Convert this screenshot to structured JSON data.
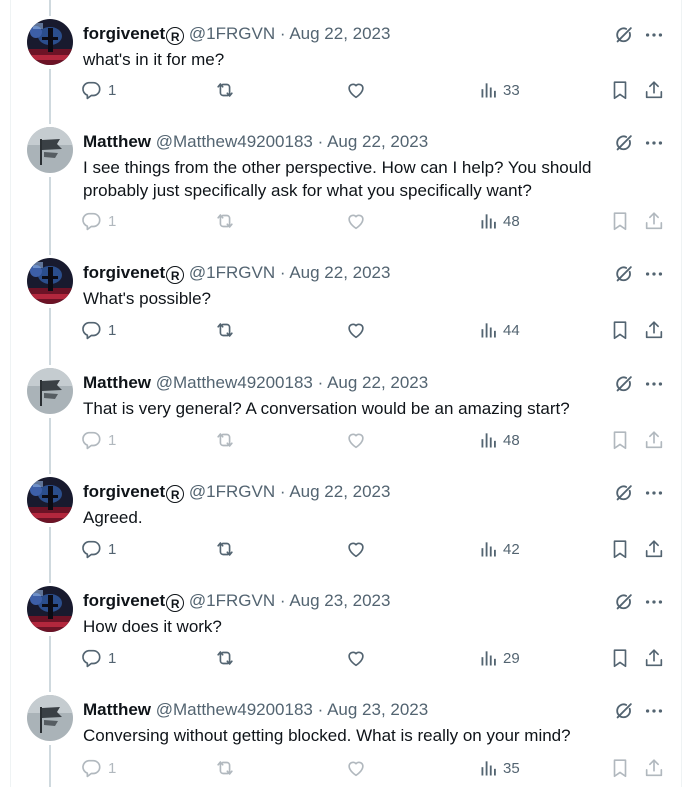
{
  "tweets": [
    {
      "name": "forgivenet",
      "badge": "R",
      "handle": "@1FRGVN",
      "date": "· Aug 22, 2023",
      "text": "what's in it for me?",
      "replies": "1",
      "views": "33",
      "avatar": "forgive",
      "faded": false
    },
    {
      "name": "Matthew",
      "badge": "",
      "handle": "@Matthew49200183",
      "date": "· Aug 22, 2023",
      "text": "I see things from the other perspective.  How can I help?  You should probably just specifically ask for what you specifically want?",
      "replies": "1",
      "views": "48",
      "avatar": "matthew",
      "faded": true
    },
    {
      "name": "forgivenet",
      "badge": "R",
      "handle": "@1FRGVN",
      "date": "· Aug 22, 2023",
      "text": "What's possible?",
      "replies": "1",
      "views": "44",
      "avatar": "forgive",
      "faded": false
    },
    {
      "name": "Matthew",
      "badge": "",
      "handle": "@Matthew49200183",
      "date": "· Aug 22, 2023",
      "text": "That is very general?  A conversation would be an amazing start?",
      "replies": "1",
      "views": "48",
      "avatar": "matthew",
      "faded": true
    },
    {
      "name": "forgivenet",
      "badge": "R",
      "handle": "@1FRGVN",
      "date": "· Aug 22, 2023",
      "text": "Agreed.",
      "replies": "1",
      "views": "42",
      "avatar": "forgive",
      "faded": false
    },
    {
      "name": "forgivenet",
      "badge": "R",
      "handle": "@1FRGVN",
      "date": "· Aug 23, 2023",
      "text": "How does it work?",
      "replies": "1",
      "views": "29",
      "avatar": "forgive",
      "faded": false
    },
    {
      "name": "Matthew",
      "badge": "",
      "handle": "@Matthew49200183",
      "date": "· Aug 23, 2023",
      "text": "Conversing without getting blocked.  What is really on your mind?",
      "replies": "1",
      "views": "35",
      "avatar": "matthew",
      "faded": true
    }
  ],
  "icons": {
    "reply": "reply-icon",
    "retweet": "retweet-icon",
    "like": "heart-icon",
    "views": "views-chart-icon",
    "bookmark": "bookmark-icon",
    "share": "share-icon",
    "grok": "grok-icon",
    "more": "more-icon"
  },
  "colors": {
    "text": "#0f1419",
    "secondary": "#536471",
    "thread_line": "#cfd9de",
    "border": "#eff3f4"
  }
}
